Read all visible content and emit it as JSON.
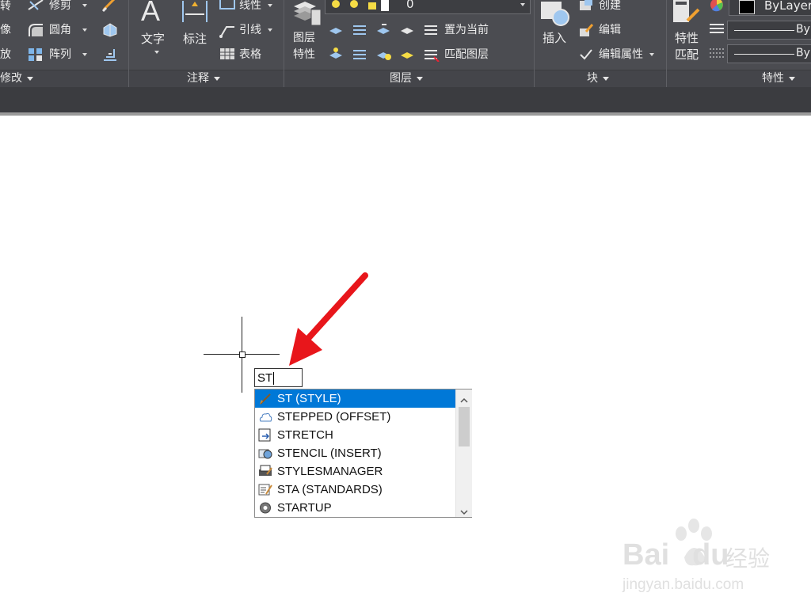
{
  "ribbon": {
    "modify_panel": {
      "rows": [
        "转",
        "像",
        "放"
      ],
      "trim_label": "修剪",
      "fillet_label": "圆角",
      "array_label": "阵列",
      "title": "修改"
    },
    "annotation_panel": {
      "text_label": "文字",
      "dimension_label": "标注",
      "linear_label": "线性",
      "leader_label": "引线",
      "table_label": "表格",
      "title": "注释"
    },
    "layers_panel": {
      "layer_properties_label": "图层\n特性",
      "layer_properties_line1": "图层",
      "layer_properties_line2": "特性",
      "current_layer_value": "0",
      "set_current_label": "置为当前",
      "match_layer_label": "匹配图层",
      "title": "图层"
    },
    "block_panel": {
      "insert_label": "插入",
      "create_label": "创建",
      "edit_label": "编辑",
      "edit_attributes_label": "编辑属性",
      "title": "块"
    },
    "properties_panel": {
      "match_properties_line1": "特性",
      "match_properties_line2": "匹配",
      "color_value": "ByLayer",
      "linetype_value": "ByL",
      "lineweight_value": "ByL",
      "title": "特性"
    }
  },
  "command": {
    "input_value": "ST"
  },
  "autocomplete": {
    "items": [
      {
        "label": "ST (STYLE)",
        "icon": "style-brush-icon",
        "selected": true
      },
      {
        "label": "STEPPED (OFFSET)",
        "icon": "offset-cloud-icon",
        "selected": false
      },
      {
        "label": "STRETCH",
        "icon": "stretch-icon",
        "selected": false
      },
      {
        "label": "STENCIL (INSERT)",
        "icon": "insert-block-icon",
        "selected": false
      },
      {
        "label": "STYLESMANAGER",
        "icon": "styles-manager-icon",
        "selected": false
      },
      {
        "label": "STA (STANDARDS)",
        "icon": "standards-icon",
        "selected": false
      },
      {
        "label": "STARTUP",
        "icon": "gear-icon",
        "selected": false
      }
    ]
  },
  "colors": {
    "ribbon_bg": "#4b4c51",
    "selection": "#0078d7",
    "arrow": "#e8161b"
  },
  "watermark": {
    "brand": "Bai",
    "brand2": "du",
    "product": "经验",
    "url": "jingyan.baidu.com"
  }
}
